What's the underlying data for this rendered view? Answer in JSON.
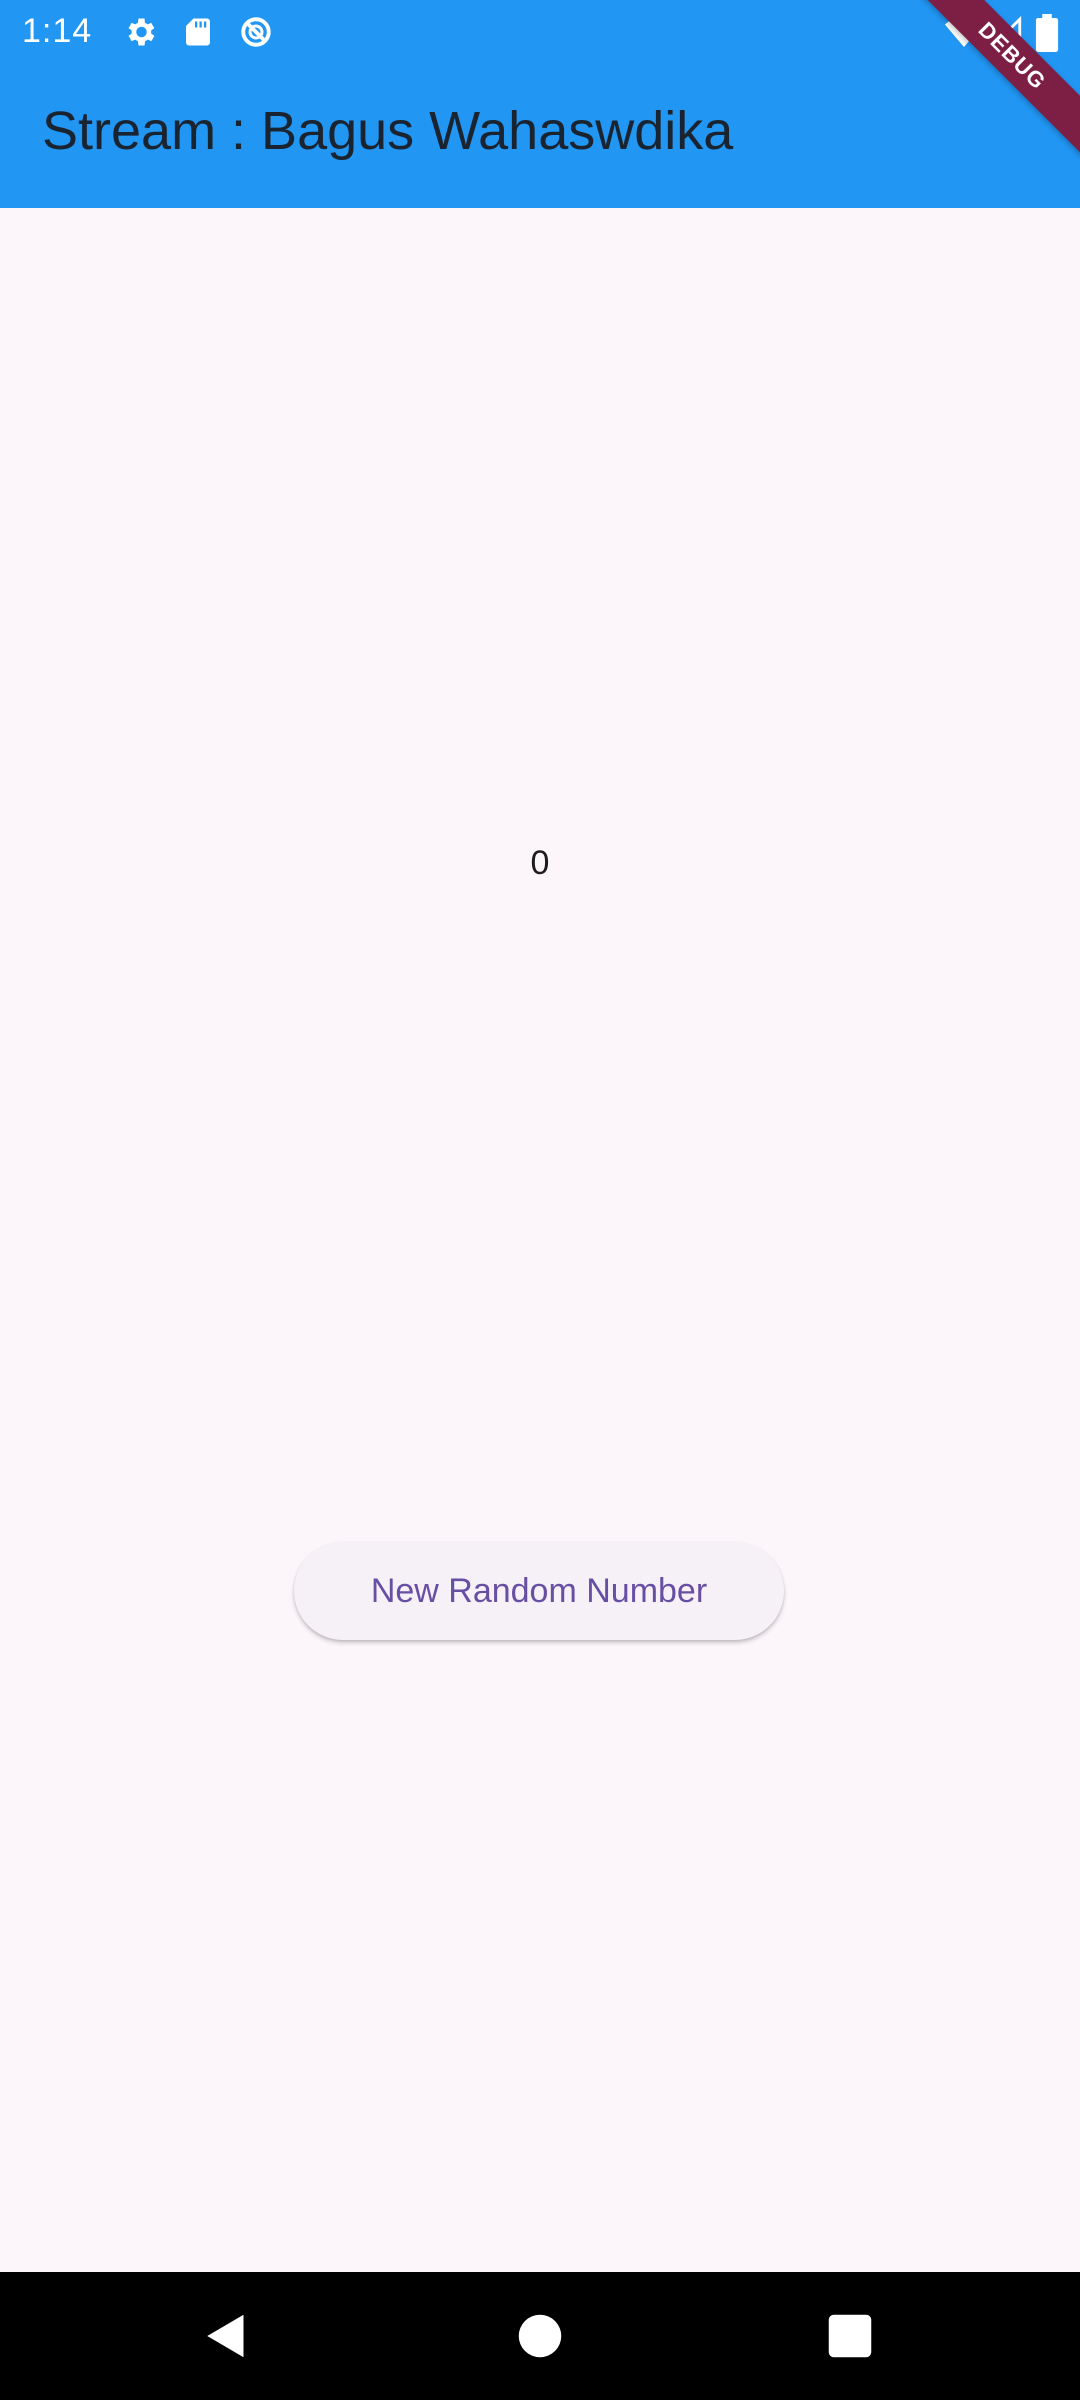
{
  "status_bar": {
    "time": "1:14",
    "icons_left": [
      "settings-icon",
      "sd-card-icon",
      "no-disturb-icon"
    ],
    "icons_right": [
      "wifi-icon",
      "signal-icon",
      "battery-icon"
    ]
  },
  "app_bar": {
    "title": "Stream : Bagus Wahaswdika",
    "color": "#2196f3"
  },
  "debug_banner": {
    "label": "DEBUG",
    "color": "#7d1f45"
  },
  "main": {
    "number": "0",
    "button_label": "New Random Number",
    "button_text_color": "#6750a4"
  },
  "nav_bar": {
    "buttons": [
      "back-icon",
      "home-icon",
      "recents-icon"
    ]
  }
}
